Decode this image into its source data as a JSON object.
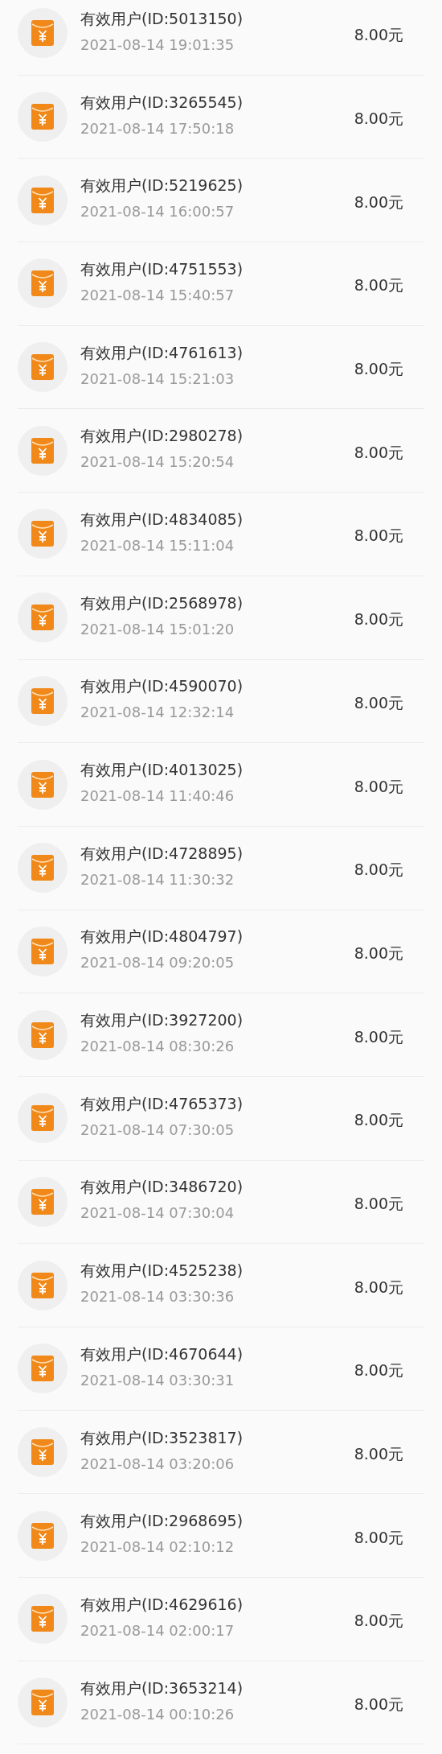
{
  "records": [
    {
      "title": "有效用户(ID:5013150)",
      "time": "2021-08-14 19:01:35",
      "amount": "8.00元"
    },
    {
      "title": "有效用户(ID:3265545)",
      "time": "2021-08-14 17:50:18",
      "amount": "8.00元"
    },
    {
      "title": "有效用户(ID:5219625)",
      "time": "2021-08-14 16:00:57",
      "amount": "8.00元"
    },
    {
      "title": "有效用户(ID:4751553)",
      "time": "2021-08-14 15:40:57",
      "amount": "8.00元"
    },
    {
      "title": "有效用户(ID:4761613)",
      "time": "2021-08-14 15:21:03",
      "amount": "8.00元"
    },
    {
      "title": "有效用户(ID:2980278)",
      "time": "2021-08-14 15:20:54",
      "amount": "8.00元"
    },
    {
      "title": "有效用户(ID:4834085)",
      "time": "2021-08-14 15:11:04",
      "amount": "8.00元"
    },
    {
      "title": "有效用户(ID:2568978)",
      "time": "2021-08-14 15:01:20",
      "amount": "8.00元"
    },
    {
      "title": "有效用户(ID:4590070)",
      "time": "2021-08-14 12:32:14",
      "amount": "8.00元"
    },
    {
      "title": "有效用户(ID:4013025)",
      "time": "2021-08-14 11:40:46",
      "amount": "8.00元"
    },
    {
      "title": "有效用户(ID:4728895)",
      "time": "2021-08-14 11:30:32",
      "amount": "8.00元"
    },
    {
      "title": "有效用户(ID:4804797)",
      "time": "2021-08-14 09:20:05",
      "amount": "8.00元"
    },
    {
      "title": "有效用户(ID:3927200)",
      "time": "2021-08-14 08:30:26",
      "amount": "8.00元"
    },
    {
      "title": "有效用户(ID:4765373)",
      "time": "2021-08-14 07:30:05",
      "amount": "8.00元"
    },
    {
      "title": "有效用户(ID:3486720)",
      "time": "2021-08-14 07:30:04",
      "amount": "8.00元"
    },
    {
      "title": "有效用户(ID:4525238)",
      "time": "2021-08-14 03:30:36",
      "amount": "8.00元"
    },
    {
      "title": "有效用户(ID:4670644)",
      "time": "2021-08-14 03:30:31",
      "amount": "8.00元"
    },
    {
      "title": "有效用户(ID:3523817)",
      "time": "2021-08-14 03:20:06",
      "amount": "8.00元"
    },
    {
      "title": "有效用户(ID:2968695)",
      "time": "2021-08-14 02:10:12",
      "amount": "8.00元"
    },
    {
      "title": "有效用户(ID:4629616)",
      "time": "2021-08-14 02:00:17",
      "amount": "8.00元"
    },
    {
      "title": "有效用户(ID:3653214)",
      "time": "2021-08-14 00:10:26",
      "amount": "8.00元"
    }
  ]
}
